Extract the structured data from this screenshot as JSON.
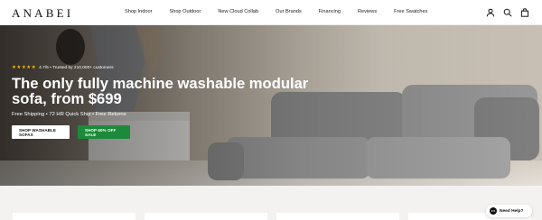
{
  "brand": {
    "logo_text": "ANABEI"
  },
  "nav": {
    "items": [
      {
        "label": "Shop Indoor"
      },
      {
        "label": "Shop Outdoor"
      },
      {
        "label": "New Cloud Collab"
      },
      {
        "label": "Our Brands"
      },
      {
        "label": "Financing"
      },
      {
        "label": "Reviews"
      },
      {
        "label": "Free Swatches"
      }
    ]
  },
  "header_icons": [
    "user-icon",
    "search-icon",
    "cart-icon"
  ],
  "hero": {
    "stars": "★★★★★",
    "rating_text": "4.7/5 • Trusted by 210,000+ customers",
    "headline": "The only fully machine washable modular sofa, from $699",
    "subline": "Free Shipping • 72 HR Quick Ship • Free Returns",
    "primary_cta": "SHOP WASHABLE SOFAS",
    "secondary_cta": "SHOP 60% OFF SALE"
  },
  "help": {
    "label": "Need Help?"
  },
  "colors": {
    "accent_green": "#1c8a3a",
    "star_color": "#f5b700",
    "header_bg": "#ffffff",
    "page_bg": "#f3f2f0"
  }
}
